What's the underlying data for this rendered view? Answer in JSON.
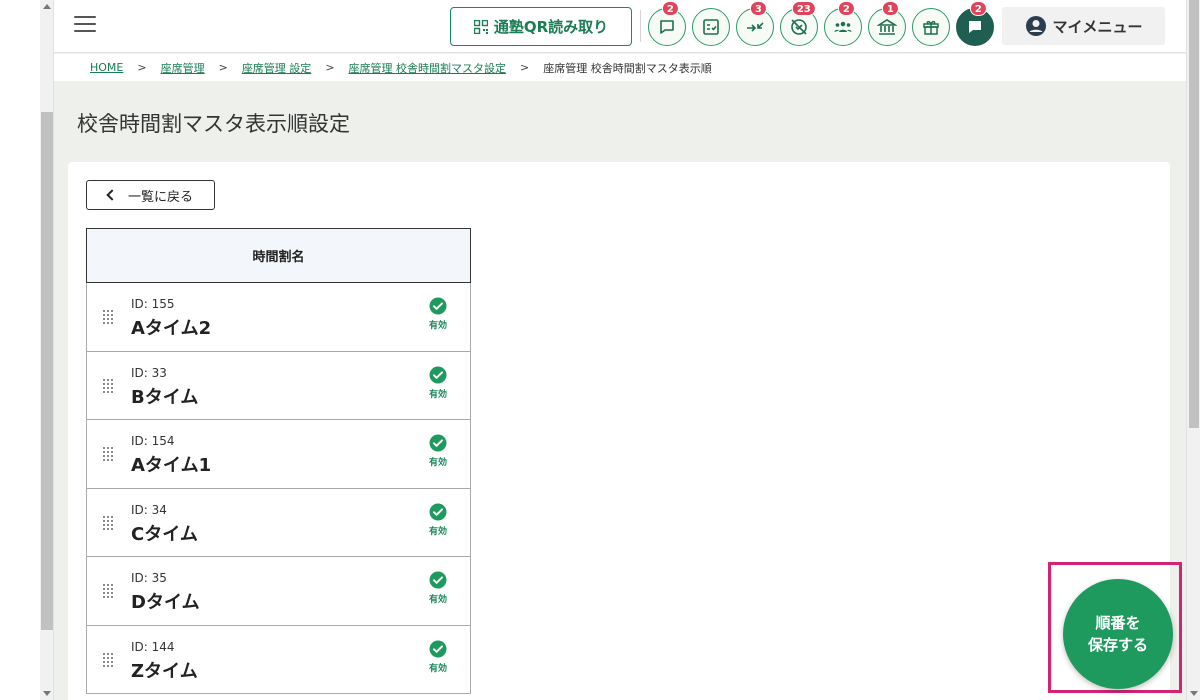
{
  "header": {
    "qr_button_label": "通塾QR読み取り",
    "icons": [
      {
        "name": "message-icon",
        "badge": "2"
      },
      {
        "name": "checklist-icon",
        "badge": ""
      },
      {
        "name": "transfer-icon",
        "badge": "3"
      },
      {
        "name": "absence-icon",
        "badge": "23"
      },
      {
        "name": "group-icon",
        "badge": "2"
      },
      {
        "name": "school-icon",
        "badge": "1"
      },
      {
        "name": "gift-icon",
        "badge": ""
      },
      {
        "name": "chat-icon",
        "badge": "2"
      }
    ],
    "my_menu_label": "マイメニュー"
  },
  "breadcrumb": {
    "items": [
      {
        "label": "HOME",
        "link": true
      },
      {
        "label": "座席管理",
        "link": true
      },
      {
        "label": "座席管理 設定",
        "link": true
      },
      {
        "label": "座席管理 校舎時間割マスタ設定",
        "link": true
      },
      {
        "label": "座席管理 校舎時間割マスタ表示順",
        "link": false
      }
    ],
    "separator": ">"
  },
  "page": {
    "title": "校舎時間割マスタ表示順設定"
  },
  "back_button_label": "一覧に戻る",
  "table": {
    "header": "時間割名",
    "rows": [
      {
        "id_label": "ID: 155",
        "name": "Aタイム2",
        "status": "有効"
      },
      {
        "id_label": "ID: 33",
        "name": "Bタイム",
        "status": "有効"
      },
      {
        "id_label": "ID: 154",
        "name": "Aタイム1",
        "status": "有効"
      },
      {
        "id_label": "ID: 34",
        "name": "Cタイム",
        "status": "有効"
      },
      {
        "id_label": "ID: 35",
        "name": "Dタイム",
        "status": "有効"
      },
      {
        "id_label": "ID: 144",
        "name": "Zタイム",
        "status": "有効"
      }
    ]
  },
  "save_button": {
    "line1": "順番を",
    "line2": "保存する"
  },
  "colors": {
    "brand_green": "#1f9a5f",
    "badge_red": "#e0435a",
    "highlight_magenta": "#d42374",
    "background": "#eef0ec"
  }
}
